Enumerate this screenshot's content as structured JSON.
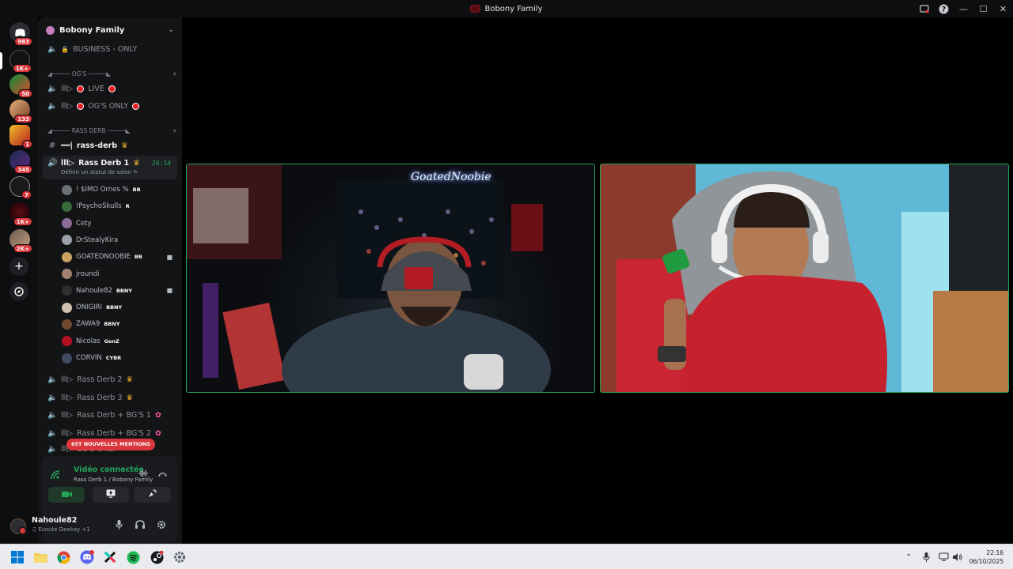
{
  "window": {
    "title": "Bobony Family"
  },
  "rail": {
    "badges": [
      "983",
      "1K+",
      "50",
      "133",
      "1",
      "345",
      "7",
      "1K+",
      "2K+"
    ]
  },
  "guild": {
    "name": "Bobony Family"
  },
  "channels": {
    "business": "BUSINESS - ONLY",
    "cat_og": "◢───── OG'S ─────◣",
    "live": "LIVE",
    "og_only": "OG'S ONLY",
    "cat_rass": "◢───── RASS DERB ─────◣",
    "rass_text": "rass-derb",
    "rass1": "Rass Derb 1",
    "rass1_timer": "26:14",
    "rass1_status": "Définir un statut de salon",
    "rass2": "Rass Derb 2",
    "rass3": "Rass Derb 3",
    "bg1": "Rass Derb + BG'S 1",
    "bg2": "Rass Derb + BG'S 2",
    "bg_only": "BG'S ONLY"
  },
  "members": [
    {
      "name": "! $IMO Ornes %",
      "tag": "BB"
    },
    {
      "name": "!PsychoSkulls",
      "tag": "R"
    },
    {
      "name": "Cety",
      "tag": ""
    },
    {
      "name": "DrStealyKira",
      "tag": ""
    },
    {
      "name": "GOATEDNOOBIE",
      "tag": "BB"
    },
    {
      "name": "jroundi",
      "tag": ""
    },
    {
      "name": "Nahoule82",
      "tag": "BBNY"
    },
    {
      "name": "ONIGIRI",
      "tag": "BBNY"
    },
    {
      "name": "ZAWA9",
      "tag": "BBNY"
    },
    {
      "name": "Nicolas",
      "tag": "GenZ"
    },
    {
      "name": "CORVIN",
      "tag": "CYBR"
    }
  ],
  "mentions_badge": "65T NOUVELLES MENTIONS",
  "voice": {
    "status": "Vidéo connectée",
    "location": "Rass Derb 1 / Bobony Family"
  },
  "user": {
    "name": "Nahoule82",
    "status": "Écoute Deekay +1"
  },
  "stage": {
    "neon_sign": "GoatedNoobie"
  },
  "taskbar": {
    "time": "22:16",
    "date": "06/10/2025"
  }
}
